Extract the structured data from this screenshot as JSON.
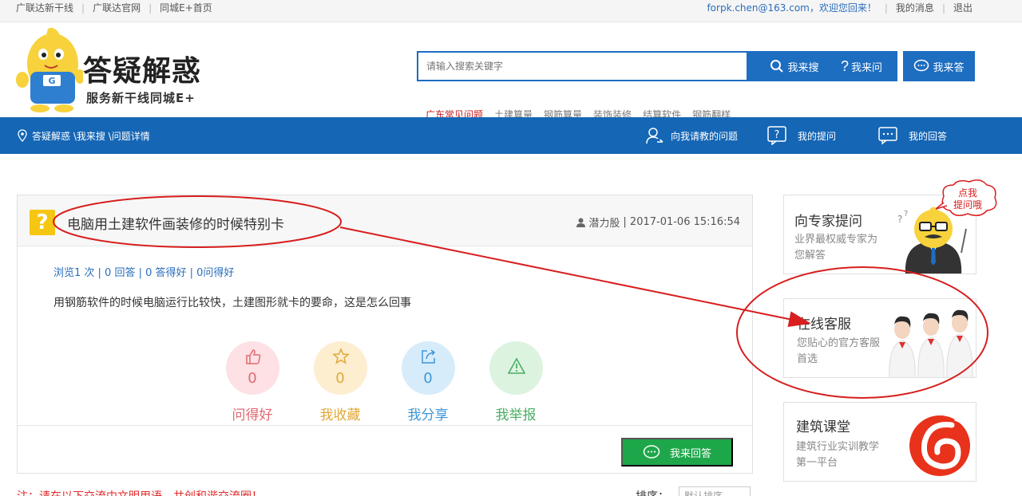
{
  "topbar": {
    "links": [
      "广联达新干线",
      "广联达官网",
      "同城E+首页"
    ],
    "email": "forpk.chen@163.com，欢迎您回来！",
    "messages": "我的消息",
    "logout": "退出"
  },
  "logo": {
    "title": "答疑解惑",
    "subtitle": "服务新干线同城E+",
    "mascot_letter": "G"
  },
  "search": {
    "placeholder": "请输入搜索关键字",
    "search_label": "我来搜",
    "ask_label": "我来问",
    "answer_label": "我来答",
    "hotwords": [
      "广东常见问题",
      "土建算量",
      "钢筋算量",
      "装饰装修",
      "结算软件",
      "钢筋翻样"
    ]
  },
  "nav": {
    "breadcrumb": "答疑解惑 \\我来搜 \\问题详情",
    "items": [
      "向我请教的问题",
      "我的提问",
      "我的回答"
    ]
  },
  "question": {
    "icon": "?",
    "title": "电脑用土建软件画装修的时候特别卡",
    "author": "潜力股",
    "datetime": "| 2017-01-06 15:16:54",
    "stats": "浏览1 次 | 0 回答 | 0 答得好 | 0问得好",
    "body": "用钢筋软件的时候电脑运行比较快，土建图形就卡的要命，这是怎么回事",
    "actions": [
      {
        "count": "0",
        "label": "问得好",
        "color": "#e06a72",
        "bg": "#fde1e4"
      },
      {
        "count": "0",
        "label": "我收藏",
        "color": "#e1a83a",
        "bg": "#fdeed0"
      },
      {
        "count": "0",
        "label": "我分享",
        "color": "#3d97d8",
        "bg": "#d7ecfb"
      },
      {
        "count": "",
        "label": "我举报",
        "color": "#4bae64",
        "bg": "#dcf3e0"
      }
    ],
    "reply_label": "我来回答"
  },
  "notice": "注：请在以下交流中文明用语，共创和谐交流圈！",
  "sort": {
    "label": "排序：",
    "value": "默认排序"
  },
  "sidebar": {
    "expert": {
      "title": "向专家提问",
      "desc": "业界最权威专家为您解答",
      "bubble": "点我\n提问哦"
    },
    "service": {
      "title": "在线客服",
      "desc": "您贴心的官方客服首选"
    },
    "course": {
      "title": "建筑课堂",
      "desc": "建筑行业实训教学第一平台"
    }
  },
  "colors": {
    "brand": "#1566b5",
    "annotation": "#d81e1e",
    "green": "#1ea74a"
  }
}
